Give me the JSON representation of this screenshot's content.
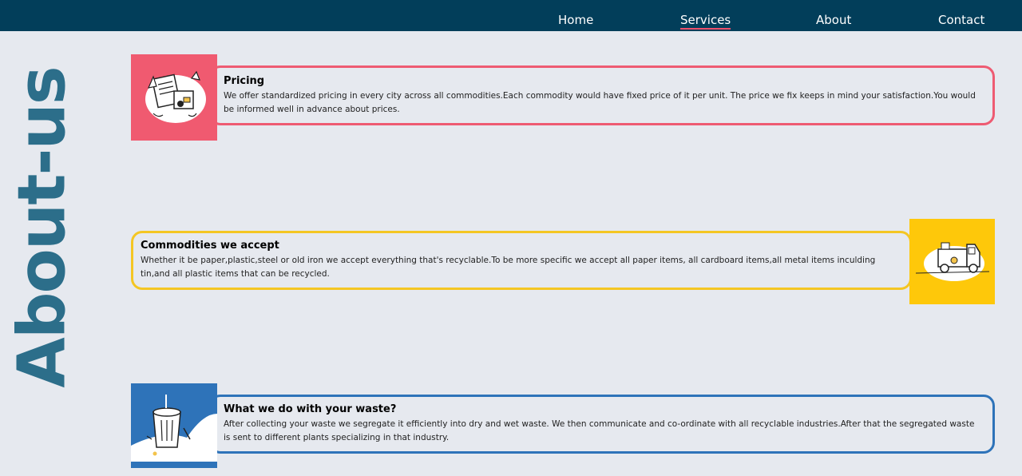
{
  "nav": {
    "items": [
      "Home",
      "Services",
      "About",
      "Contact"
    ],
    "active": "Services"
  },
  "side_title": "About-us",
  "cards": [
    {
      "title": "Pricing",
      "text": "We offer standardized pricing in every city across all commodities.Each commodity would have fixed price of it per unit. The price we fix keeps in mind your satisfaction.You would be informed well in advance about prices.",
      "accent": "#ee5b72",
      "icon": "pricing-illustration-icon"
    },
    {
      "title": "Commodities we accept",
      "text": "Whether it be paper,plastic,steel or old iron we accept everything that's recyclable.To be more specific we accept all paper items, all cardboard items,all metal items inculding tin,and all plastic items that can be recycled.",
      "accent": "#f4c623",
      "icon": "truck-illustration-icon"
    },
    {
      "title": "What we do with your waste?",
      "text": "After collecting your waste we segregate it efficiently into dry and wet waste. We then communicate and co-ordinate with all recyclable industries.After that the segregated waste is sent to different plants specializing in that industry.",
      "accent": "#2e73b9",
      "icon": "trash-bin-illustration-icon"
    }
  ],
  "colors": {
    "navbar": "#023e5a",
    "background": "#e6e9ef",
    "side_title": "#2c6e8a",
    "active_underline": "#ee4f6b"
  }
}
